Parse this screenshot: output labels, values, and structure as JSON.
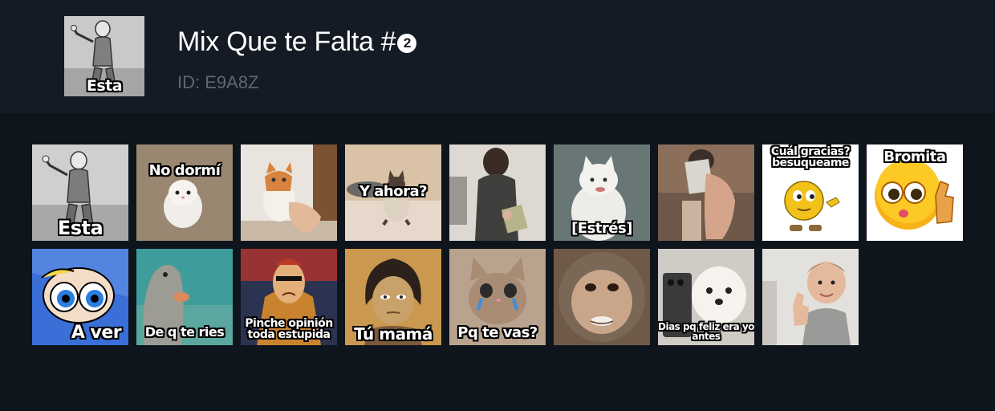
{
  "pack": {
    "title": "Mix Que te Falta #",
    "badge": "2",
    "id_text": "ID: E9A8Z",
    "cover_caption": "Esta"
  },
  "stickers": [
    {
      "caption": "Esta",
      "icon": "cartoon-boy-thumbs-up"
    },
    {
      "caption": "No dormí",
      "icon": "white-kitten"
    },
    {
      "caption": "",
      "icon": "orange-white-cat"
    },
    {
      "caption": "Y ahora?",
      "icon": "siamese-cat"
    },
    {
      "caption": "",
      "icon": "girl-holding-money"
    },
    {
      "caption": "[Estrés]",
      "icon": "white-cat-stressed"
    },
    {
      "caption": "",
      "icon": "hand-holding-card"
    },
    {
      "caption": "Cuál gracias? besuqueame",
      "icon": "yellow-emoji-shoes"
    },
    {
      "caption": "Bromita",
      "icon": "emoji-thumbs-up"
    },
    {
      "caption": "A ver",
      "icon": "powerpuff-girl"
    },
    {
      "caption": "De q te ries",
      "icon": "fish-lips"
    },
    {
      "caption": "Pinche opinión toda estupida",
      "icon": "cartoon-villain"
    },
    {
      "caption": "Tú mamá",
      "icon": "cartoon-woman"
    },
    {
      "caption": "Pq te vas?",
      "icon": "crying-kitten"
    },
    {
      "caption": "",
      "icon": "monkey-face"
    },
    {
      "caption": "Dias pq feliz era yo antes",
      "icon": "white-dog-phone"
    },
    {
      "caption": "",
      "icon": "baby-thumbs-up"
    }
  ]
}
